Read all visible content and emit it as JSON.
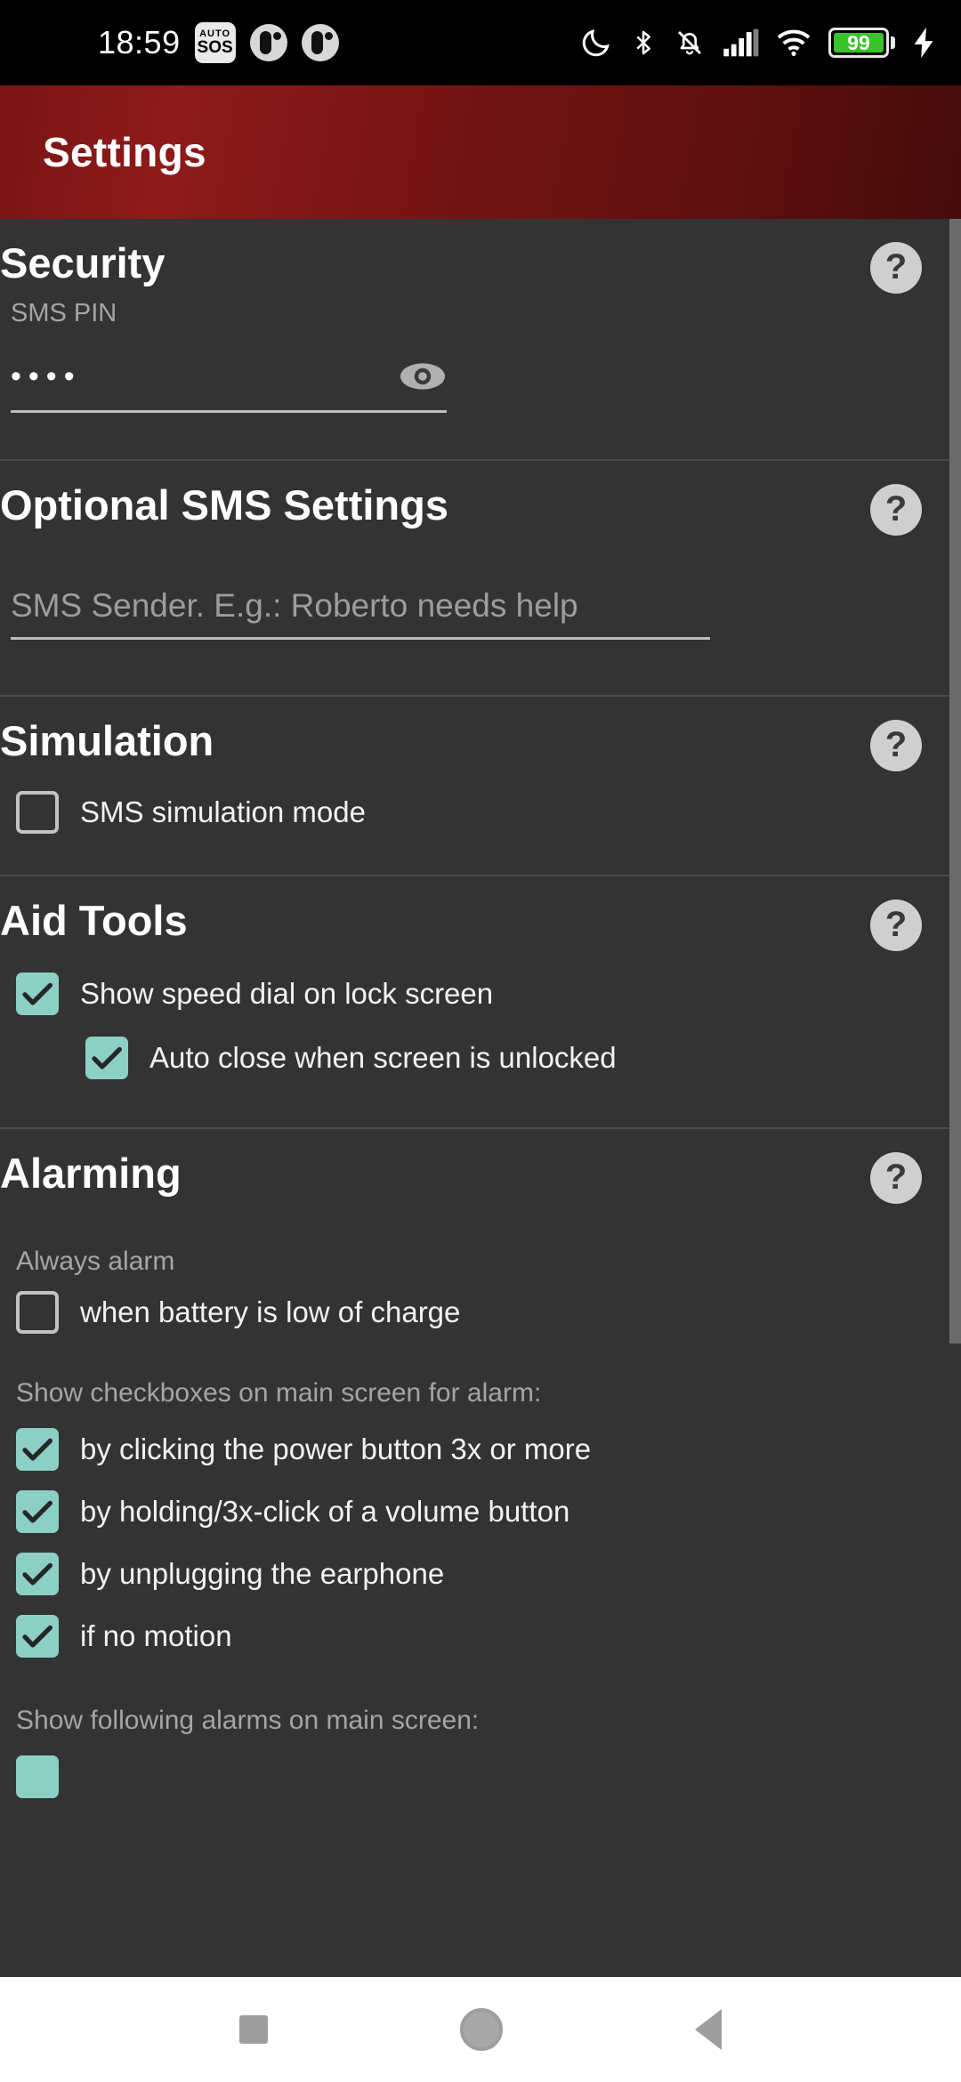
{
  "status_bar": {
    "time": "18:59",
    "sos_badge": {
      "top": "AUTO",
      "bottom": "SOS"
    },
    "icons_left": [
      "auto-sos-badge",
      "app-icon-1",
      "app-icon-2"
    ],
    "icons_right": [
      "do-not-disturb-moon-icon",
      "bluetooth-icon",
      "notifications-muted-icon",
      "cellular-signal-icon",
      "wifi-icon",
      "battery-icon",
      "charging-bolt-icon"
    ],
    "battery_percent": "99",
    "battery_color": "#3ac22a"
  },
  "titlebar": {
    "title": "Settings",
    "background_color": "#6d1212"
  },
  "help_label": "?",
  "sections": [
    {
      "title": "Security",
      "sub_label": "SMS PIN",
      "pin_value": "••••",
      "pin_placeholder": "SMS PIN",
      "visibility_toggle": "eye-icon"
    },
    {
      "title": "Optional SMS Settings",
      "sender_value": "",
      "sender_placeholder": "SMS Sender. E.g.: Roberto needs help"
    },
    {
      "title": "Simulation",
      "checkboxes": [
        {
          "label": "SMS simulation mode",
          "checked": false
        }
      ]
    },
    {
      "title": "Aid Tools",
      "checkboxes": [
        {
          "label": "Show speed dial on lock screen",
          "checked": true,
          "indent": false
        },
        {
          "label": "Auto close when screen is unlocked",
          "checked": true,
          "indent": true
        }
      ]
    },
    {
      "title": "Alarming",
      "group_always_alarm": "Always alarm",
      "always_alarm_items": [
        {
          "label": "when battery is low of charge",
          "checked": false
        }
      ],
      "group_show_checkboxes": "Show checkboxes on main screen for alarm:",
      "show_checkbox_items": [
        {
          "label": "by clicking the power button 3x or more",
          "checked": true
        },
        {
          "label": "by holding/3x-click of a volume button",
          "checked": true
        },
        {
          "label": "by unplugging the earphone",
          "checked": true
        },
        {
          "label": "if no motion",
          "checked": true
        }
      ],
      "group_show_alarms": "Show following alarms on main screen:"
    }
  ],
  "checkbox_checked_color": "#8ccfc5",
  "navbar": {
    "recents_label": "recents-square-icon",
    "home_label": "home-circle-icon",
    "back_label": "back-triangle-icon"
  }
}
